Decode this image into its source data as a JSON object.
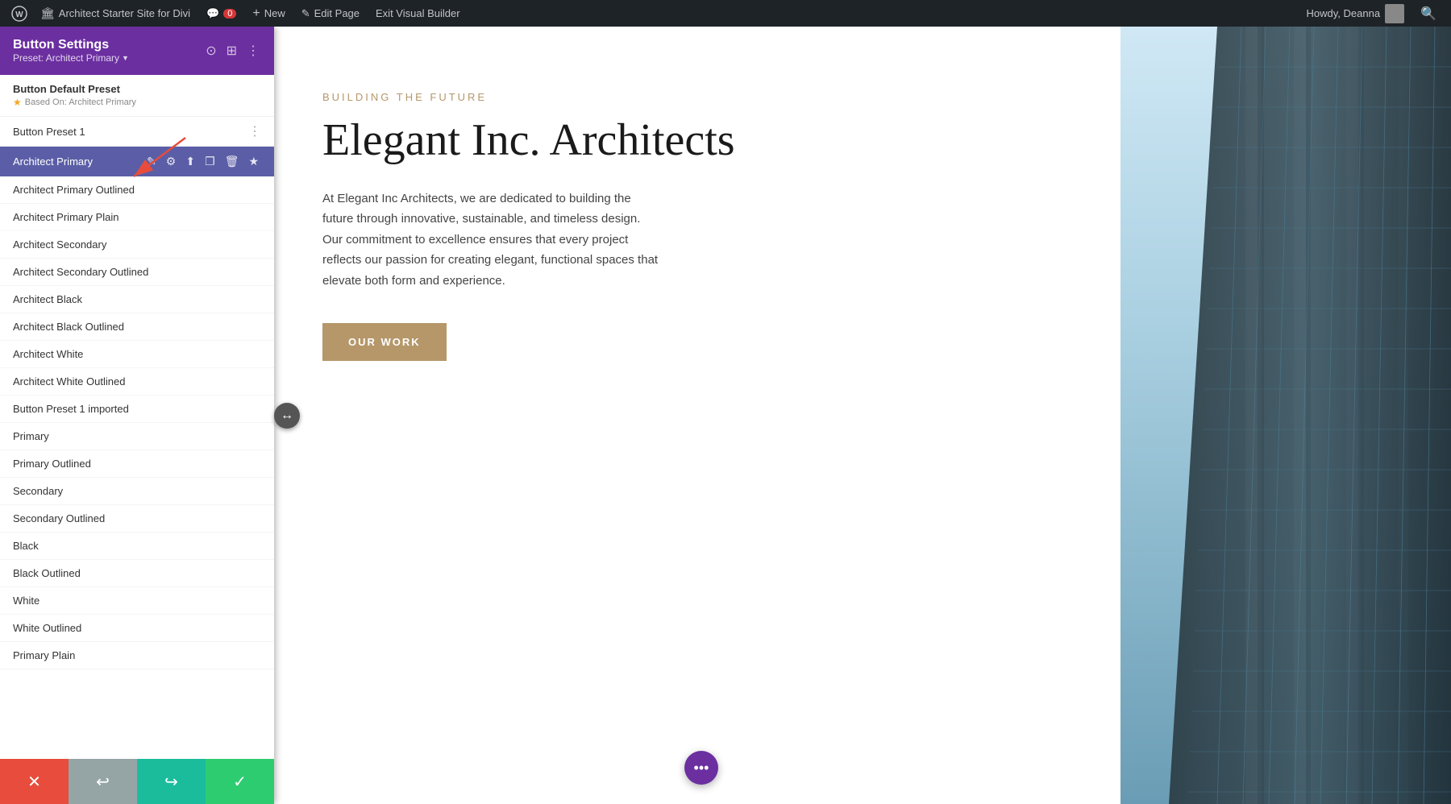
{
  "adminbar": {
    "site_name": "Architect Starter Site for Divi",
    "comment_count": "0",
    "new_label": "New",
    "edit_page_label": "Edit Page",
    "exit_builder_label": "Exit Visual Builder",
    "howdy": "Howdy, Deanna"
  },
  "panel": {
    "title": "Button Settings",
    "preset_label": "Preset: Architect Primary",
    "default_preset_title": "Button Default Preset",
    "default_preset_sub": "Based On: Architect Primary",
    "button_preset_1": "Button Preset 1",
    "active_preset": "Architect Primary",
    "presets": [
      "Architect Primary Outlined",
      "Architect Primary Plain",
      "Architect Secondary",
      "Architect Secondary Outlined",
      "Architect Black",
      "Architect Black Outlined",
      "Architect White",
      "Architect White Outlined",
      "Button Preset 1 imported",
      "Primary",
      "Primary Outlined",
      "Secondary",
      "Secondary Outlined",
      "Black",
      "Black Outlined",
      "White",
      "White Outlined",
      "Primary Plain"
    ]
  },
  "page": {
    "subtitle": "BUILDING THE FUTURE",
    "title": "Elegant Inc. Architects",
    "description": "At Elegant Inc Architects, we are dedicated to building the future through innovative, sustainable, and timeless design. Our commitment to excellence ensures that every project reflects our passion for creating elegant, functional spaces that elevate both form and experience.",
    "cta_button": "OUR WORK"
  },
  "bottom_toolbar": {
    "cancel_icon": "✕",
    "undo_icon": "↩",
    "redo_icon": "↪",
    "save_icon": "✓"
  },
  "icons": {
    "wp_logo": "W",
    "comment": "💬",
    "plus": "+",
    "pencil": "✎",
    "search": "🔍",
    "dots_vertical": "⋮",
    "dots_horiz": "···",
    "edit": "✎",
    "gear": "⚙",
    "upload": "⬆",
    "copy": "❐",
    "trash": "🗑",
    "star": "★",
    "arrow_lr": "↔"
  },
  "colors": {
    "purple": "#6b2fa0",
    "active_preset_bg": "#5b5ea6",
    "button_gold": "#b5976a",
    "red": "#e74c3c",
    "gray": "#95a5a6",
    "teal": "#1abc9c",
    "green": "#2ecc71"
  }
}
